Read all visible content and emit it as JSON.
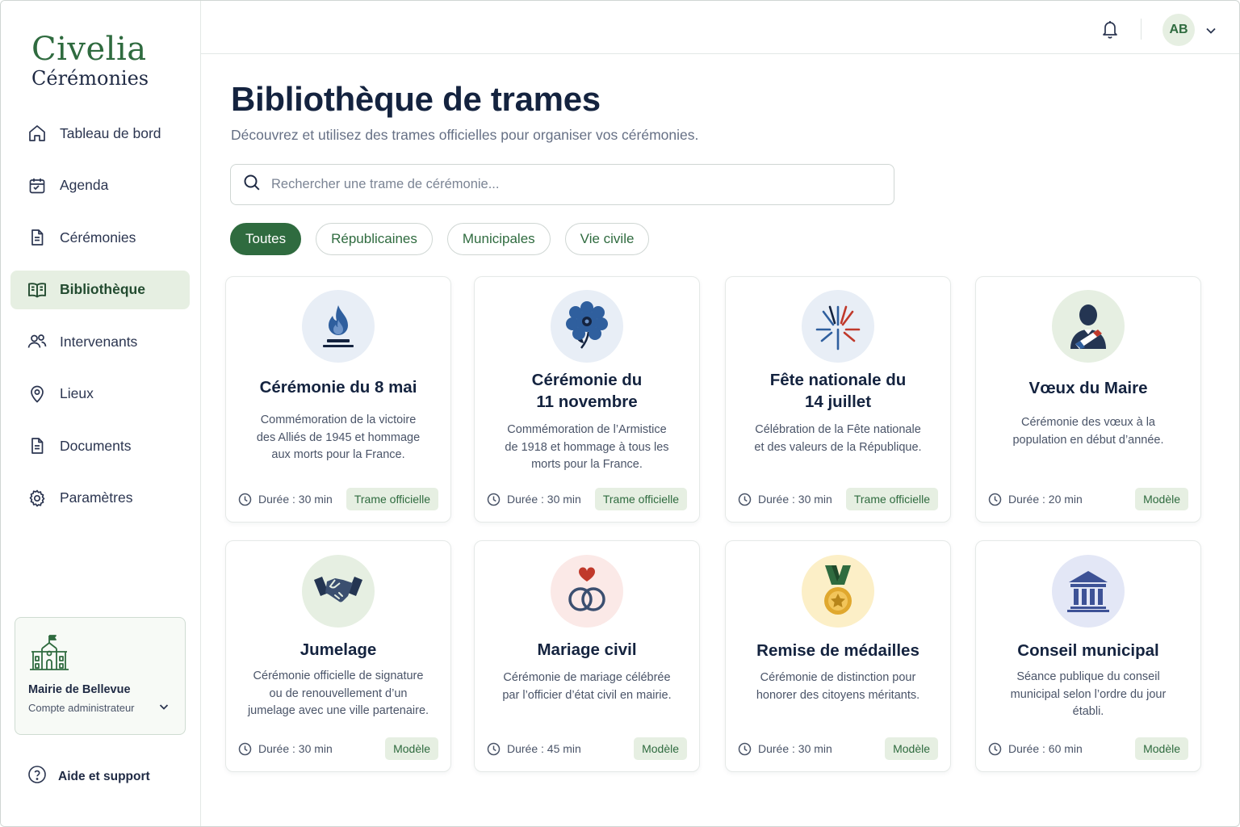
{
  "brand": {
    "title": "Civelia",
    "subtitle": "Cérémonies"
  },
  "nav": [
    {
      "label": "Tableau de bord",
      "icon": "home-icon"
    },
    {
      "label": "Agenda",
      "icon": "calendar-icon"
    },
    {
      "label": "Cérémonies",
      "icon": "document-icon"
    },
    {
      "label": "Bibliothèque",
      "icon": "book-icon",
      "active": true
    },
    {
      "label": "Intervenants",
      "icon": "users-icon"
    },
    {
      "label": "Lieux",
      "icon": "map-pin-icon"
    },
    {
      "label": "Documents",
      "icon": "file-icon"
    },
    {
      "label": "Paramètres",
      "icon": "gear-icon"
    }
  ],
  "account": {
    "name": "Mairie de Bellevue",
    "role": "Compte administrateur"
  },
  "help_label": "Aide et support",
  "header": {
    "avatar_initials": "AB"
  },
  "page": {
    "title": "Bibliothèque de trames",
    "subtitle": "Découvrez et utilisez des trames officielles pour organiser vos cérémonies."
  },
  "search": {
    "placeholder": "Rechercher une trame de cérémonie...",
    "value": ""
  },
  "filters": [
    "Toutes",
    "Républicaines",
    "Municipales",
    "Vie civile"
  ],
  "active_filter": "Toutes",
  "cards": [
    {
      "title_lines": [
        "Cérémonie du 8 mai"
      ],
      "desc_lines": [
        "Commémoration de la victoire",
        "des Alliés de 1945 et hommage",
        "aux morts pour la France."
      ],
      "duration": "Durée : 30 min",
      "badge": "Trame officielle",
      "icon": "flame-icon"
    },
    {
      "title_lines": [
        "Cérémonie du",
        "11 novembre"
      ],
      "desc_lines": [
        "Commémoration de l’Armistice",
        "de 1918 et hommage à tous les",
        "morts pour la France."
      ],
      "duration": "Durée : 30 min",
      "badge": "Trame officielle",
      "icon": "bleuet-flower-icon"
    },
    {
      "title_lines": [
        "Fête nationale du",
        "14 juillet"
      ],
      "desc_lines": [
        "Célébration de la Fête nationale",
        "et des valeurs de la République."
      ],
      "duration": "Durée : 30 min",
      "badge": "Trame officielle",
      "icon": "fireworks-icon"
    },
    {
      "title_lines": [
        "Vœux du Maire"
      ],
      "desc_lines": [
        "Cérémonie des vœux à la",
        "population en début d’année."
      ],
      "duration": "Durée : 20 min",
      "badge": "Modèle",
      "icon": "mayor-sash-icon"
    },
    {
      "title_lines": [
        "Jumelage"
      ],
      "desc_lines": [
        "Cérémonie officielle de signature",
        "ou de renouvellement d’un",
        "jumelage avec une ville partenaire."
      ],
      "duration": "Durée : 30 min",
      "badge": "Modèle",
      "icon": "handshake-icon"
    },
    {
      "title_lines": [
        "Mariage civil"
      ],
      "desc_lines": [
        "Cérémonie de mariage célébrée",
        "par l’officier d’état civil en mairie."
      ],
      "duration": "Durée : 45 min",
      "badge": "Modèle",
      "icon": "wedding-rings-icon"
    },
    {
      "title_lines": [
        "Remise de médailles"
      ],
      "desc_lines": [
        "Cérémonie de distinction pour",
        "honorer des citoyens méritants."
      ],
      "duration": "Durée : 30 min",
      "badge": "Modèle",
      "icon": "medal-icon"
    },
    {
      "title_lines": [
        "Conseil municipal"
      ],
      "desc_lines": [
        "Séance publique du conseil",
        "municipal selon l’ordre du jour",
        "établi."
      ],
      "duration": "Durée : 60 min",
      "badge": "Modèle",
      "icon": "town-hall-icon"
    }
  ],
  "colors": {
    "primary": "#2f6b3f",
    "primary_light": "#e6efe2",
    "navy": "#14233f",
    "blue": "#2f5f9e",
    "red": "#c0392b"
  }
}
